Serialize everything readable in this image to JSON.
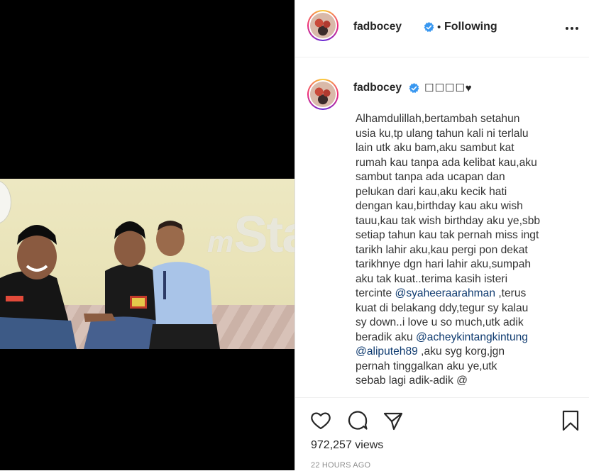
{
  "post": {
    "username": "fadbocey",
    "follow_status": "Following",
    "separator": "•",
    "caption_emoji": "☐☐☐☐♥",
    "caption_text": "Alhamdulillah,bertambah setahun\nusia ku,tp ulang tahun kali ni terlalu\nlain utk aku bam,aku sambut kat\nrumah kau tanpa ada kelibat kau,aku\nsambut tanpa ada ucapan dan\npelukan dari kau,aku kecik hati\ndengan kau,birthday kau aku wish\ntauu,kau tak wish birthday aku ye,sbb\nsetiap tahun kau tak pernah miss ingt\ntarikh lahir aku,kau pergi pon dekat\ntarikhnye dgn hari lahir aku,sumpah\naku tak kuat..terima kasih isteri\ntercinte ",
    "mention_1": "@syaheeraarahman",
    "caption_text_2": " ,terus\nkuat di belakang ddy,tegur sy kalau\nsy down..i love u so much,utk adik\nberadik aku ",
    "mention_2": "@acheykintangkintung",
    "caption_text_3": "\n",
    "mention_3": "@aliputeh89",
    "caption_text_4": " ,aku syg korg,jgn\npernah tinggalkan aku ye,utk\nsebab lagi adik-adik @",
    "views": "972,257 views",
    "timestamp": "22 HOURS AGO"
  },
  "watermark": {
    "prefix": "m",
    "text": "Star"
  },
  "icons": {
    "verified": "verified-badge-icon",
    "more": "more-options-icon",
    "like": "heart-icon",
    "comment": "comment-icon",
    "share": "share-icon",
    "save": "bookmark-icon"
  },
  "colors": {
    "verified": "#3897f0",
    "mention": "#0f3b70",
    "timestamp": "#8e8e8e"
  }
}
